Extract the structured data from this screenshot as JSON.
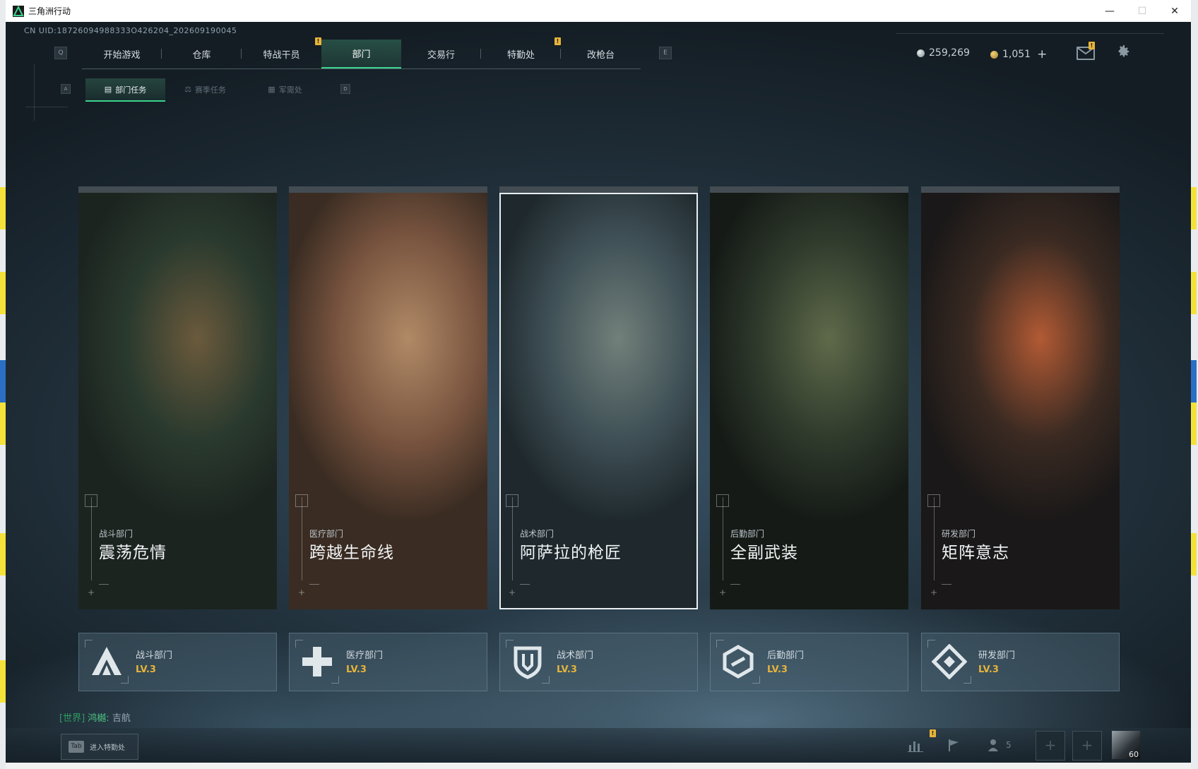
{
  "window": {
    "title": "三角洲行动",
    "controls": {
      "minimize": "—",
      "maximize": "☐",
      "close": "✕"
    }
  },
  "uid": "CN UID:18726094988333O426204_202609190045",
  "topnav": {
    "key_left": "Q",
    "key_right": "E",
    "tabs": [
      {
        "label": "开始游戏",
        "badge": ""
      },
      {
        "label": "仓库",
        "badge": ""
      },
      {
        "label": "特战干员",
        "badge": "!"
      },
      {
        "label": "部门",
        "badge": "",
        "active": true
      },
      {
        "label": "交易行",
        "badge": ""
      },
      {
        "label": "特勤处",
        "badge": "!"
      },
      {
        "label": "改枪台",
        "badge": ""
      }
    ]
  },
  "currency": {
    "coins": "259,269",
    "tickets": "1,051",
    "add": "+"
  },
  "subnav": {
    "key_left": "A",
    "key_right": "D",
    "tabs": [
      {
        "label": "部门任务",
        "icon": "clipboard-icon",
        "active": true
      },
      {
        "label": "赛季任务",
        "icon": "crest-icon"
      },
      {
        "label": "军需处",
        "icon": "crate-icon"
      }
    ]
  },
  "departments": [
    {
      "dept": "战斗部门",
      "mission": "震荡危情",
      "level": "LV.3",
      "logo": "combat-logo-icon",
      "colors": [
        "#2a3a2e",
        "#6b5a3c",
        "#1c2420"
      ]
    },
    {
      "dept": "医疗部门",
      "mission": "跨越生命线",
      "level": "LV.3",
      "logo": "medical-cross-icon",
      "colors": [
        "#7a5540",
        "#b08a66",
        "#3a2c22"
      ]
    },
    {
      "dept": "战术部门",
      "mission": "阿萨拉的枪匠",
      "level": "LV.3",
      "logo": "shield-icon",
      "colors": [
        "#3f5056",
        "#72807a",
        "#1f292d"
      ]
    },
    {
      "dept": "后勤部门",
      "mission": "全副武装",
      "level": "LV.3",
      "logo": "logistics-hex-icon",
      "colors": [
        "#2f3a2c",
        "#5f6a4a",
        "#151a16"
      ]
    },
    {
      "dept": "研发部门",
      "mission": "矩阵意志",
      "level": "LV.3",
      "logo": "research-diamond-icon",
      "colors": [
        "#3a2a22",
        "#b25a34",
        "#1a1818"
      ]
    }
  ],
  "chat": {
    "channel": "[世界]",
    "speaker": "鸿樾:",
    "message": "吉航"
  },
  "bottombar": {
    "tab_key": "Tab",
    "tab_label": "进入特勤处",
    "friends_count": "5",
    "avatar_level": "60"
  },
  "colors": {
    "accent": "#3bd38e",
    "badge": "#e7b43a",
    "level": "#e7b43a"
  }
}
